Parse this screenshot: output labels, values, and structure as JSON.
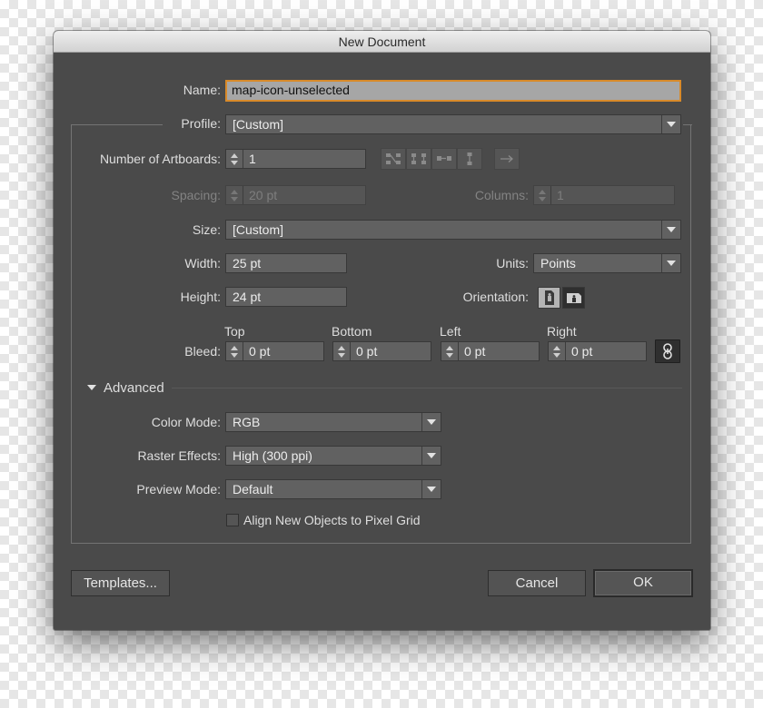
{
  "window": {
    "title": "New Document"
  },
  "name": {
    "label": "Name:",
    "value": "map-icon-unselected"
  },
  "profile": {
    "label": "Profile:",
    "value": "[Custom]"
  },
  "artboards": {
    "label": "Number of Artboards:",
    "value": "1"
  },
  "spacing": {
    "label": "Spacing:",
    "value": "20 pt"
  },
  "columns": {
    "label": "Columns:",
    "value": "1"
  },
  "size": {
    "label": "Size:",
    "value": "[Custom]"
  },
  "width": {
    "label": "Width:",
    "value": "25 pt"
  },
  "units": {
    "label": "Units:",
    "value": "Points"
  },
  "height": {
    "label": "Height:",
    "value": "24 pt"
  },
  "orientation": {
    "label": "Orientation:",
    "selected": "portrait"
  },
  "bleed": {
    "label": "Bleed:",
    "top": {
      "label": "Top",
      "value": "0 pt"
    },
    "bottom": {
      "label": "Bottom",
      "value": "0 pt"
    },
    "left": {
      "label": "Left",
      "value": "0 pt"
    },
    "right": {
      "label": "Right",
      "value": "0 pt"
    }
  },
  "advanced": {
    "label": "Advanced",
    "color_mode": {
      "label": "Color Mode:",
      "value": "RGB"
    },
    "raster_effects": {
      "label": "Raster Effects:",
      "value": "High (300 ppi)"
    },
    "preview_mode": {
      "label": "Preview Mode:",
      "value": "Default"
    },
    "pixel_grid": {
      "label": "Align New Objects to Pixel Grid",
      "checked": false
    }
  },
  "buttons": {
    "templates": "Templates...",
    "cancel": "Cancel",
    "ok": "OK"
  },
  "colors": {
    "dialog_bg": "#4a4a4a",
    "focus_ring": "#d88a2a",
    "field_bg": "#616161"
  }
}
